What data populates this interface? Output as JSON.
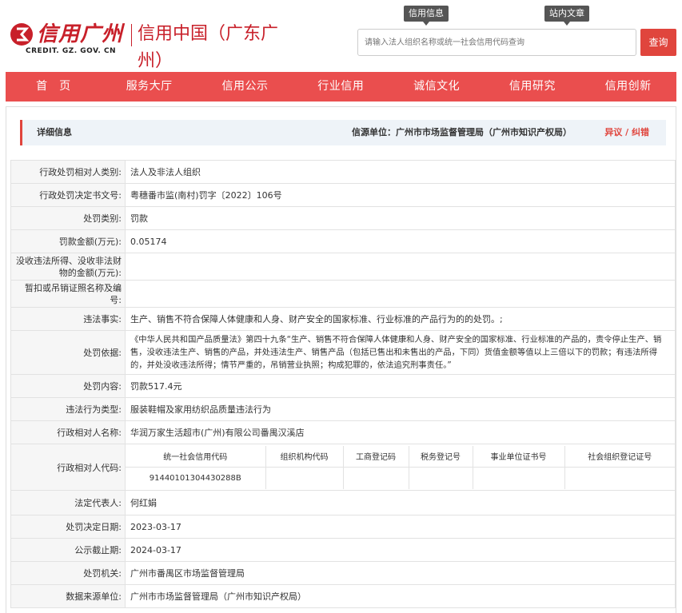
{
  "header": {
    "logo_main": "信用广州",
    "logo_sub": "CREDIT. GZ. GOV. CN",
    "site_title": "信用中国（广东广州）",
    "tags": [
      "信用信息",
      "站内文章"
    ],
    "search_placeholder": "请输入法人组织名称或统一社会信用代码查询",
    "search_button": "查询"
  },
  "nav": [
    "首　页",
    "服务大厅",
    "信用公示",
    "行业信用",
    "诚信文化",
    "信用研究",
    "信用创新"
  ],
  "info_bar": {
    "title": "详细信息",
    "source": "信源单位：广州市市场监督管理局（广州市知识产权局）",
    "objection": "异议 / 纠错"
  },
  "rows": [
    {
      "label": "行政处罚相对人类别:",
      "value": "法人及非法人组织"
    },
    {
      "label": "行政处罚决定书文号:",
      "value": "粤穗番市监(南村)罚字〔2022〕106号"
    },
    {
      "label": "处罚类别:",
      "value": "罚款"
    },
    {
      "label": "罚款金额(万元):",
      "value": "0.05174"
    },
    {
      "label": "没收违法所得、没收非法财物的金额(万元):",
      "value": ""
    },
    {
      "label": "暂扣或吊销证照名称及编号:",
      "value": ""
    },
    {
      "label": "违法事实:",
      "value": "生产、销售不符合保障人体健康和人身、财产安全的国家标准、行业标准的产品行为的的处罚。;"
    },
    {
      "label": "处罚依据:",
      "value": "《中华人民共和国产品质量法》第四十九条“生产、销售不符合保障人体健康和人身、财产安全的国家标准、行业标准的产品的，责令停止生产、销售，没收违法生产、销售的产品，并处违法生产、销售产品（包括已售出和未售出的产品，下同）货值金额等值以上三倍以下的罚款；有违法所得的，并处没收违法所得；情节严重的，吊销营业执照；构成犯罪的，依法追究刑事责任。”"
    },
    {
      "label": "处罚内容:",
      "value": "罚款517.4元"
    },
    {
      "label": "违法行为类型:",
      "value": "服装鞋帽及家用纺织品质量违法行为"
    },
    {
      "label": "行政相对人名称:",
      "value": "华润万家生活超市(广州)有限公司番禺汉溪店"
    }
  ],
  "code_row": {
    "label": "行政相对人代码:",
    "headers": [
      "统一社会信用代码",
      "组织机构代码",
      "工商登记码",
      "税务登记号",
      "事业单位证书号",
      "社会组织登记证号"
    ],
    "values": [
      "91440101304430288B",
      "",
      "",
      "",
      "",
      ""
    ]
  },
  "rows2": [
    {
      "label": "法定代表人:",
      "value": "何红娟"
    },
    {
      "label": "处罚决定日期:",
      "value": "2023-03-17"
    },
    {
      "label": "公示截止期:",
      "value": "2024-03-17"
    },
    {
      "label": "处罚机关:",
      "value": "广州市番禺区市场监督管理局"
    },
    {
      "label": "数据来源单位:",
      "value": "广州市市场监督管理局（广州市知识产权局）"
    }
  ]
}
